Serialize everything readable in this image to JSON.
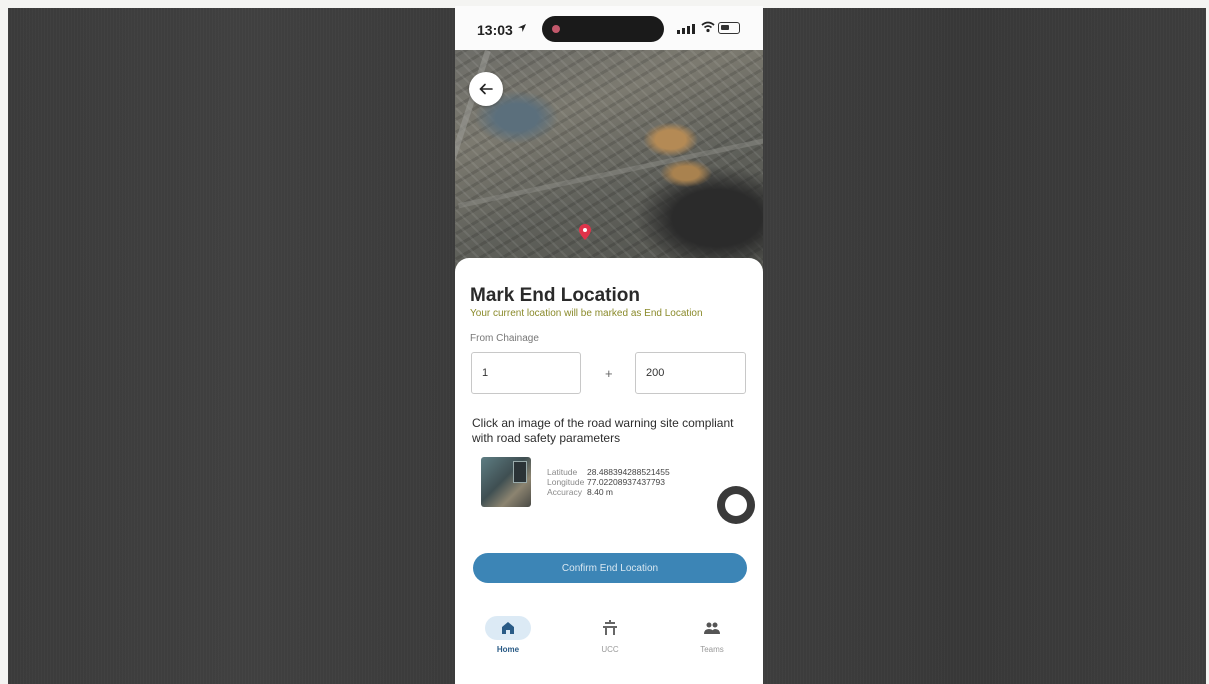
{
  "status_bar": {
    "time": "13:03"
  },
  "sheet": {
    "title": "Mark End Location",
    "subtitle": "Your current location will be marked as End Location",
    "chainage_label": "From Chainage",
    "chainage_km_value": "1",
    "plus": "+",
    "chainage_m_value": "200",
    "instruction": "Click an image of the road warning site compliant with road safety parameters",
    "geo": {
      "latitude_label": "Latitude",
      "latitude_value": "28.488394288521455",
      "longitude_label": "Longitude",
      "longitude_value": "77.02208937437793",
      "accuracy_label": "Accuracy",
      "accuracy_value": "8.40 m"
    },
    "confirm_label": "Confirm End Location"
  },
  "nav": {
    "items": [
      {
        "label": "Home",
        "icon": "home-icon",
        "active": true
      },
      {
        "label": "UCC",
        "icon": "ucc-icon",
        "active": false
      },
      {
        "label": "Teams",
        "icon": "teams-icon",
        "active": false
      }
    ]
  },
  "colors": {
    "accent": "#3c85b6",
    "subtitle": "#8a8a2a",
    "nav_active_bg": "#dceaf5"
  }
}
